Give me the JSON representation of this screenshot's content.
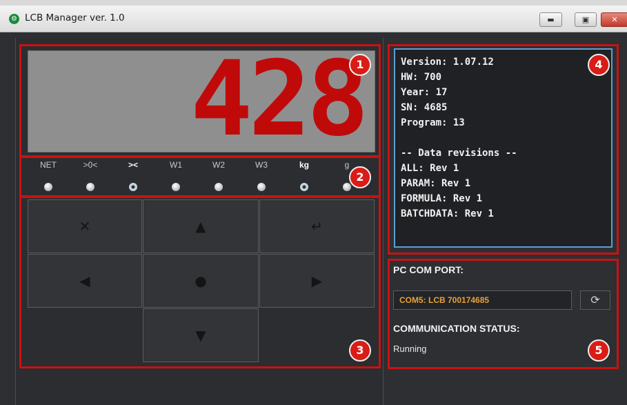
{
  "window": {
    "title": "LCB Manager ver. 1.0",
    "app_icon": "gear-icon",
    "controls": {
      "minimize": "minimize-icon",
      "maximize": "maximize-icon",
      "close": "close-icon"
    }
  },
  "display": {
    "value": "428",
    "color": "#c00a0a",
    "background": "#8f8f8f"
  },
  "indicators": [
    {
      "label": "NET",
      "bold": false,
      "on": false
    },
    {
      "label": ">0<",
      "bold": false,
      "on": false
    },
    {
      "label": "><",
      "bold": true,
      "on": true
    },
    {
      "label": "W1",
      "bold": false,
      "on": false
    },
    {
      "label": "W2",
      "bold": false,
      "on": false
    },
    {
      "label": "W3",
      "bold": false,
      "on": false
    },
    {
      "label": "kg",
      "bold": true,
      "on": true
    },
    {
      "label": "g",
      "bold": false,
      "on": false
    }
  ],
  "keypad": [
    {
      "name": "key-cancel",
      "glyph": "✕",
      "icon": "close-icon"
    },
    {
      "name": "key-up",
      "glyph": "▲",
      "icon": "arrow-up-icon"
    },
    {
      "name": "key-enter",
      "glyph": "↵",
      "icon": "enter-icon"
    },
    {
      "name": "key-left",
      "glyph": "◀",
      "icon": "arrow-left-icon"
    },
    {
      "name": "key-center",
      "glyph": "●",
      "icon": "dot-icon"
    },
    {
      "name": "key-right",
      "glyph": "▶",
      "icon": "arrow-right-icon"
    },
    {
      "name": "key-down",
      "glyph": "▼",
      "icon": "arrow-down-icon"
    }
  ],
  "info": {
    "lines": [
      "Version: 1.07.12",
      "HW: 700",
      "Year: 17",
      "SN: 4685",
      "Program: 13",
      "",
      "-- Data revisions --",
      "ALL: Rev 1",
      "PARAM: Rev 1",
      "FORMULA: Rev 1",
      "BATCHDATA: Rev 1"
    ]
  },
  "com": {
    "port_label": "PC COM PORT:",
    "port_value": "COM5: LCB 700174685",
    "refresh_icon": "refresh-icon",
    "status_label": "COMMUNICATION STATUS:",
    "status_value": "Running"
  },
  "annotations": {
    "badges": [
      "1",
      "2",
      "3",
      "4",
      "5"
    ],
    "highlight_color": "#cc1111"
  }
}
